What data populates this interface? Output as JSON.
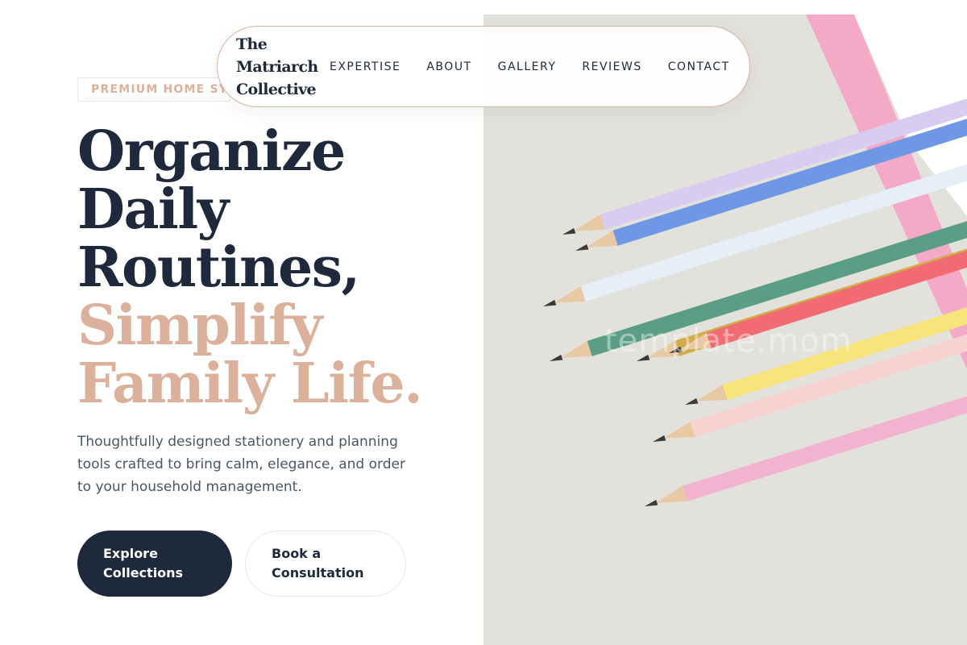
{
  "brand": {
    "name": "The Matriarch Collective"
  },
  "nav": {
    "items": [
      {
        "label": "EXPERTISE"
      },
      {
        "label": "ABOUT"
      },
      {
        "label": "GALLERY"
      },
      {
        "label": "REVIEWS"
      },
      {
        "label": "CONTACT"
      }
    ]
  },
  "hero": {
    "eyebrow": "PREMIUM HOME SYSTEMS",
    "headline_lines": [
      "Organize",
      "Daily",
      "Routines,"
    ],
    "headline_accent_lines": [
      "Simplify",
      "Family Life."
    ],
    "lead": "Thoughtfully designed stationery and planning tools crafted to bring calm, elegance, and order to your household management.",
    "primary_button": "Explore Collections",
    "secondary_button": "Book a Consultation"
  },
  "image": {
    "watermark": "template.mom",
    "pencil_colors": [
      "#d8cdf0",
      "#6e97e6",
      "#e6eef7",
      "#5a9e86",
      "#d3ad4a",
      "#f7e47a",
      "#f7d2d0",
      "#f2b3d0",
      "#f26a72"
    ]
  },
  "colors": {
    "navy": "#1e293b",
    "accent": "#dcb19c",
    "muted_text": "#4a5568",
    "nav_border": "#d9b4a0"
  }
}
